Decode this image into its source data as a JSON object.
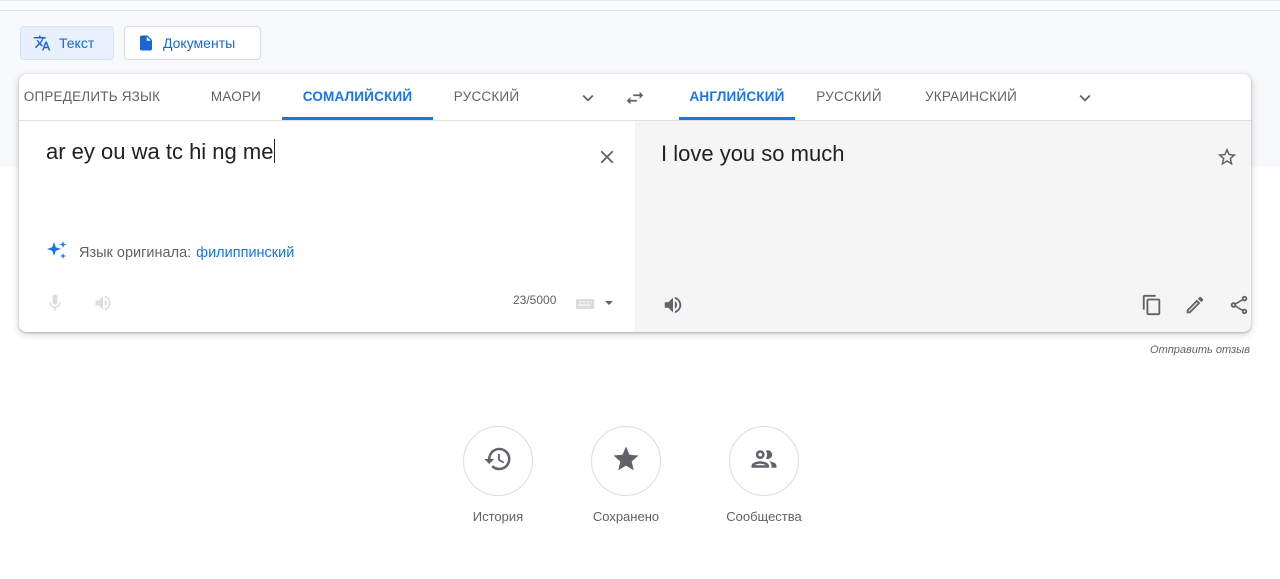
{
  "modes": {
    "text_label": "Текст",
    "documents_label": "Документы"
  },
  "source_langs": [
    {
      "label": "ОПРЕДЕЛИТЬ ЯЗЫК",
      "active": false
    },
    {
      "label": "МАОРИ",
      "active": false
    },
    {
      "label": "СОМАЛИЙСКИЙ",
      "active": true
    },
    {
      "label": "РУССКИЙ",
      "active": false
    }
  ],
  "target_langs": [
    {
      "label": "АНГЛИЙСКИЙ",
      "active": true
    },
    {
      "label": "РУССКИЙ",
      "active": false
    },
    {
      "label": "УКРАИНСКИЙ",
      "active": false
    }
  ],
  "source": {
    "text": "ar ey ou wa tc hi ng me",
    "detected_label": "Язык оригинала:",
    "detected_value": "филиппинский",
    "char_count": "23/5000"
  },
  "target": {
    "text": "I love you so much"
  },
  "feedback_label": "Отправить отзыв",
  "bottom": {
    "history_label": "История",
    "saved_label": "Сохранено",
    "community_label": "Сообщества"
  },
  "colors": {
    "accent": "#1a73e8",
    "active_tab_bg": "#e8f0fe",
    "target_pane_bg": "#f5f5f5"
  },
  "icons": [
    "translate-icon",
    "document-icon",
    "chevron-down-icon",
    "swap-icon",
    "clear-icon",
    "star-icon",
    "sparkle-icon",
    "mic-icon",
    "speaker-icon",
    "keyboard-icon",
    "copy-icon",
    "edit-icon",
    "share-icon",
    "history-icon",
    "saved-star-icon",
    "community-icon"
  ]
}
